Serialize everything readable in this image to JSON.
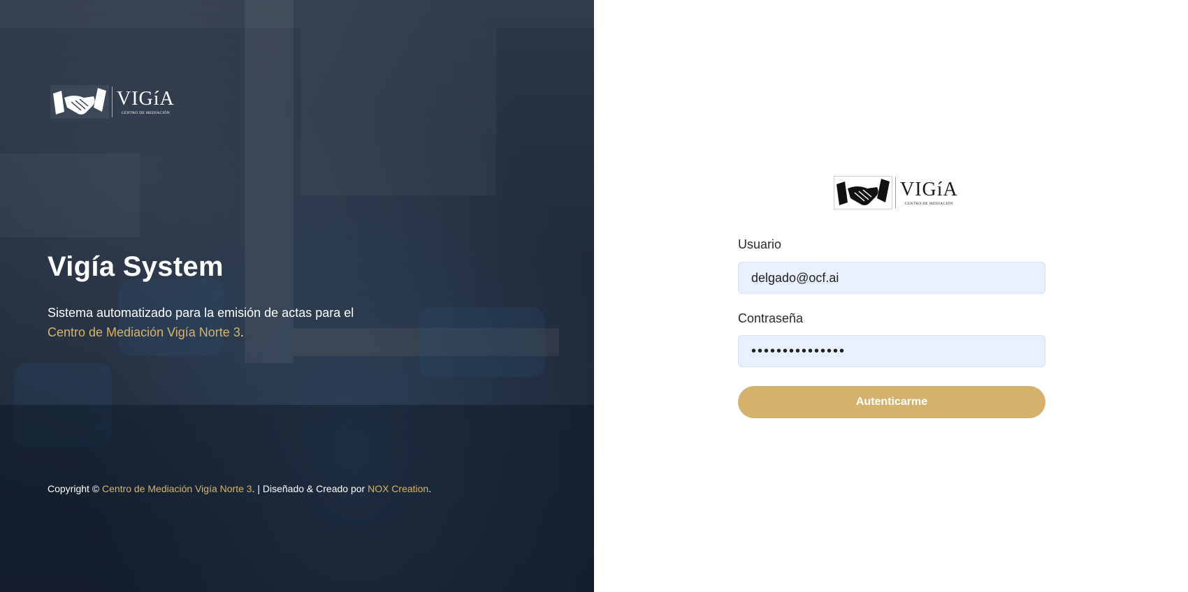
{
  "brand": {
    "logo_word": "VIGíA",
    "logo_subtitle": "CENTRO DE MEDIACIÓN",
    "accent_color": "#d4b26c",
    "icon": "handshake-icon"
  },
  "hero": {
    "title": "Vigía System",
    "description_prefix": "Sistema automatizado para la emisión de actas para el",
    "description_link": "Centro de Mediación Vigía Norte 3",
    "description_suffix": ".",
    "footer": {
      "copyright_prefix": "Copyright © ",
      "org_link": "Centro de Mediación Vigía Norte 3",
      "middle": ". | Diseñado & Creado por ",
      "creator_link": "NOX Creation",
      "suffix": "."
    }
  },
  "login": {
    "username_label": "Usuario",
    "username_value": "delgado@ocf.ai",
    "password_label": "Contraseña",
    "password_value": "•••••••••••••••",
    "submit_label": "Autenticarme"
  }
}
